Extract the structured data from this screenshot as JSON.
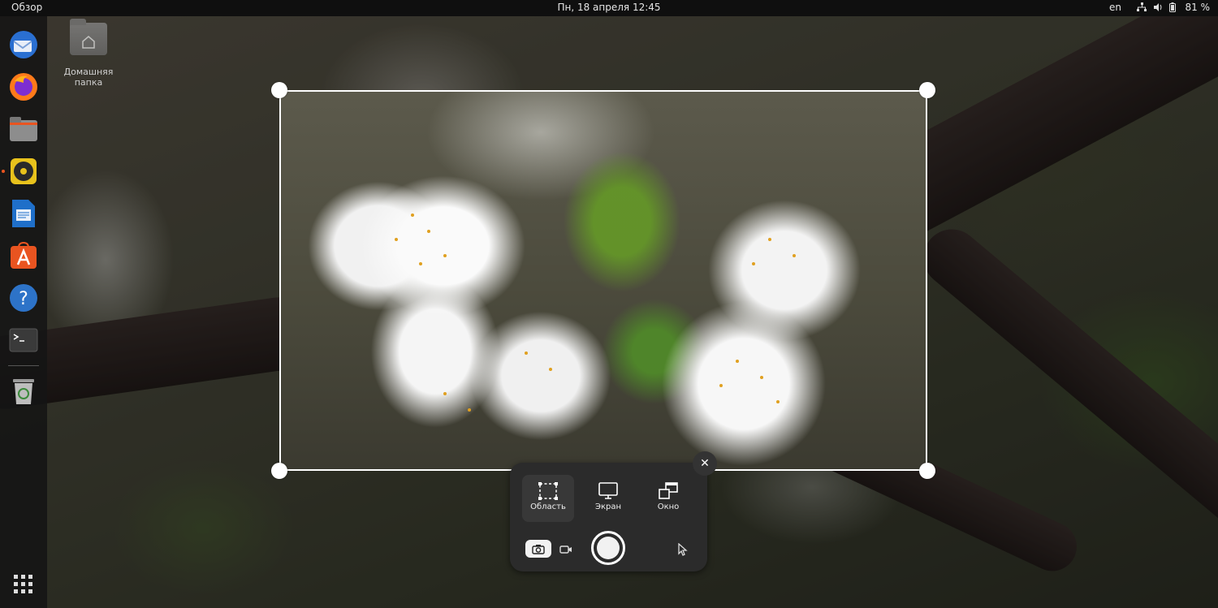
{
  "topbar": {
    "activities": "Обзор",
    "datetime": "Пн, 18 апреля  12:45",
    "language": "en",
    "battery": "81 %"
  },
  "dock": {
    "items": [
      "thunderbird-icon",
      "firefox-icon",
      "files-icon",
      "rhythmbox-icon",
      "writer-icon",
      "software-icon",
      "help-icon",
      "terminal-icon",
      "trash-icon",
      "app-grid-icon"
    ]
  },
  "desktop": {
    "home_folder_label": "Домашняя папка"
  },
  "screenshot_ui": {
    "modes": {
      "area": "Область",
      "screen": "Экран",
      "window": "Окно"
    },
    "selected_mode": "area",
    "capture_type": "screenshot"
  },
  "colors": {
    "accent": "#e95420",
    "panel_bg": "#2b2b2b"
  }
}
